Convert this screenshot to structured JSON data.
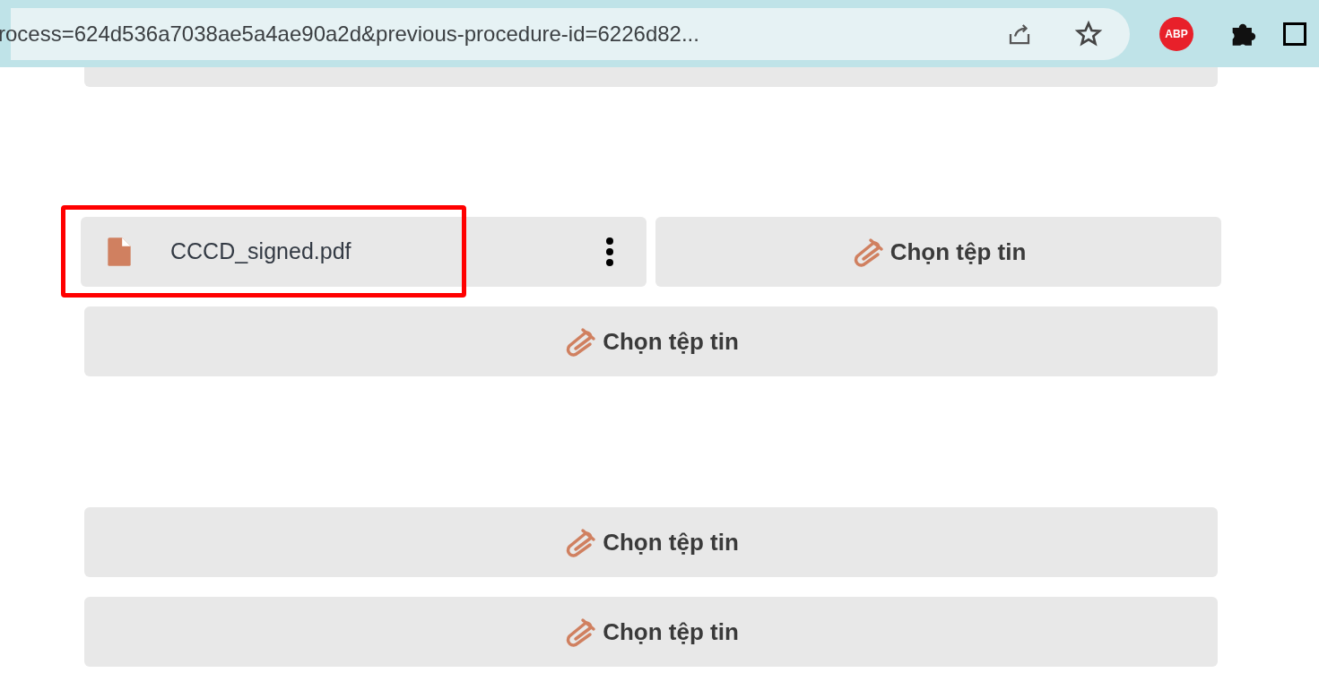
{
  "browser": {
    "url": "rocess=624d536a7038ae5a4ae90a2d&previous-procedure-id=6226d82...",
    "extension_badge": "ABP"
  },
  "groups": [
    {
      "rows": [
        {
          "kind": "file",
          "file": {
            "name": "CCCD_signed.pdf",
            "highlighted": true
          },
          "button": "Chọn tệp tin"
        },
        {
          "kind": "button",
          "button": "Chọn tệp tin"
        }
      ]
    },
    {
      "rows": [
        {
          "kind": "button",
          "button": "Chọn tệp tin"
        },
        {
          "kind": "button",
          "button": "Chọn tệp tin"
        }
      ]
    }
  ]
}
